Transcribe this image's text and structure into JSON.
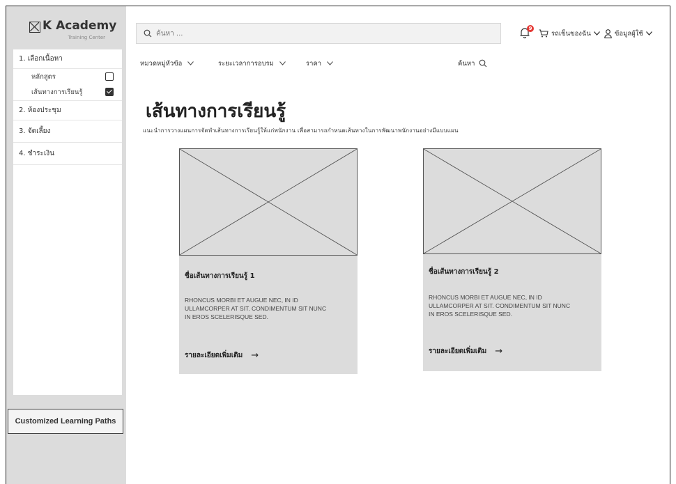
{
  "brand": {
    "title": "K Academy",
    "subtitle": "Training Center"
  },
  "sidebar": {
    "items": [
      {
        "label": "1. เลือกเนื้อหา"
      },
      {
        "label": "2. ห้องประชุม"
      },
      {
        "label": "3. จัดเลี้ยง"
      },
      {
        "label": "4. ชำระเงิน"
      }
    ],
    "subitems": [
      {
        "label": "หลักสูตร",
        "checked": false
      },
      {
        "label": "เส้นทางการเรียนรู้",
        "checked": true
      }
    ],
    "custom_button": "Customized Learning Paths"
  },
  "search": {
    "placeholder": "ค้นหา ..."
  },
  "topbar": {
    "notification_count": "9",
    "cart_label": "รถเข็นของฉัน",
    "user_label": "ข้อมูลผู้ใช้"
  },
  "filters": {
    "category": "หมวดหมู่หัวข้อ",
    "duration": "ระยะเวลาการอบรม",
    "price": "ราคา",
    "search_label": "ค้นหา"
  },
  "page": {
    "title": "เส้นทางการเรียนรู้",
    "description": "แนะนำการวางแผนการจัดทำเส้นทางการเรียนรู้ให้แก่พนักงาน เพื่อสามารถกำหนดเส้นทางในการพัฒนาพนักงานอย่างมีแบบแผน"
  },
  "cards": [
    {
      "title": "ชื่อเส้นทางการเรียนรู้ 1",
      "body": "RHONCUS MORBI ET AUGUE NEC, IN ID ULLAMCORPER AT SIT. CONDIMENTUM SIT NUNC IN EROS SCELERISQUE SED.",
      "more": "รายละเอียดเพิ่มเติม"
    },
    {
      "title": "ชื่อเส้นทางการเรียนรู้ 2",
      "body": "RHONCUS MORBI ET AUGUE NEC, IN ID ULLAMCORPER AT SIT. CONDIMENTUM SIT NUNC IN EROS SCELERISQUE SED.",
      "more": "รายละเอียดเพิ่มเติม"
    }
  ],
  "colors": {
    "sidebar_bg": "#dcdcdc",
    "badge": "#e53935",
    "card_bg": "#dcdcdc"
  }
}
